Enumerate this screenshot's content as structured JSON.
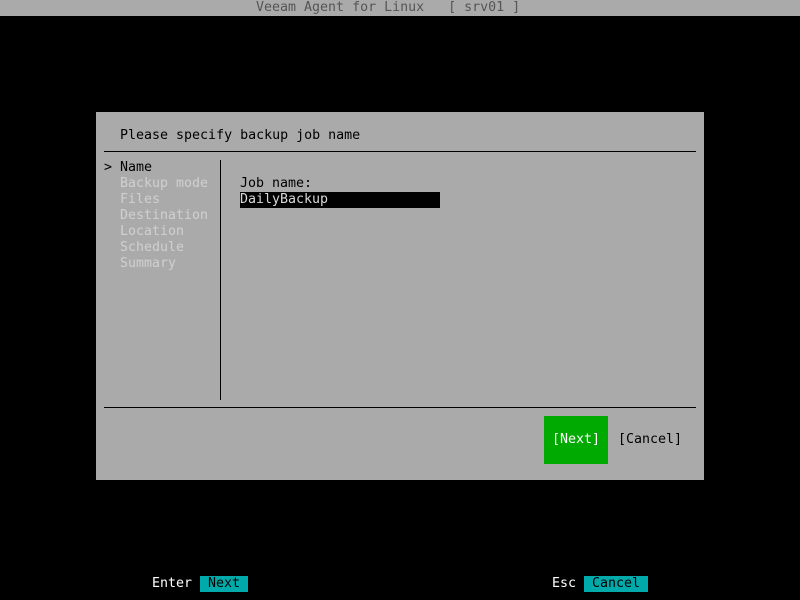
{
  "window": {
    "title": "Veeam Agent for Linux   [ srv01 ]"
  },
  "dialog": {
    "heading": "Please specify backup job name",
    "nav": {
      "marker": ">",
      "items": [
        {
          "label": "Name",
          "active": true
        },
        {
          "label": "Backup mode",
          "active": false
        },
        {
          "label": "Files",
          "active": false
        },
        {
          "label": "Destination",
          "active": false
        },
        {
          "label": "Location",
          "active": false
        },
        {
          "label": "Schedule",
          "active": false
        },
        {
          "label": "Summary",
          "active": false
        }
      ]
    },
    "job_name": {
      "label": "Job name:",
      "value": "DailyBackup"
    },
    "buttons": {
      "next": "[Next]",
      "cancel": "[Cancel]"
    }
  },
  "footer": {
    "enter_key": "Enter",
    "enter_action": "Next",
    "esc_key": "Esc",
    "esc_action": "Cancel"
  },
  "colors": {
    "background": "#000000",
    "dialog": "#aaaaaa",
    "primary_button": "#00aa00",
    "hint": "#00aaaa"
  }
}
